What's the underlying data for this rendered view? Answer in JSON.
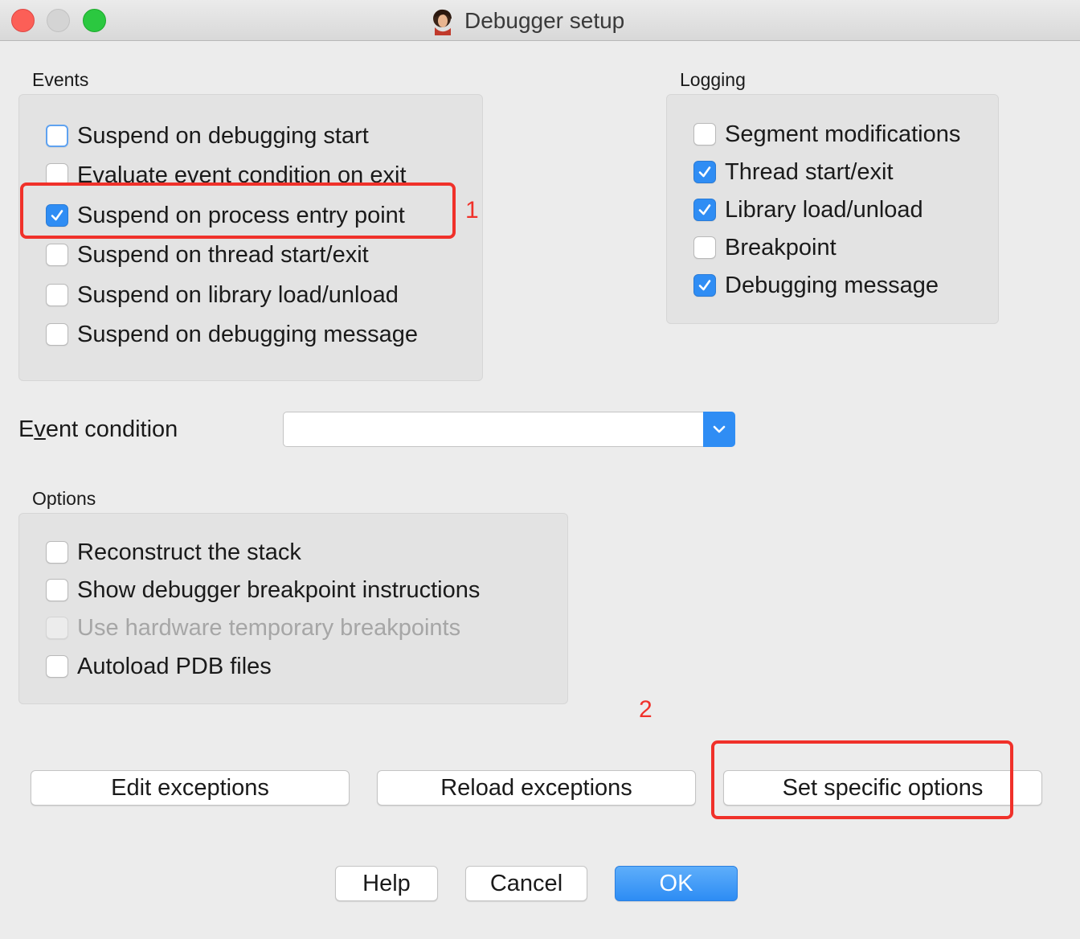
{
  "window": {
    "title": "Debugger setup"
  },
  "events": {
    "label": "Events",
    "items": [
      {
        "label": "Suspend on debugging start",
        "checked": false
      },
      {
        "label": "Evaluate event condition on exit",
        "checked": false
      },
      {
        "label": "Suspend on process entry point",
        "checked": true
      },
      {
        "label": "Suspend on thread start/exit",
        "checked": false
      },
      {
        "label": "Suspend on library load/unload",
        "checked": false
      },
      {
        "label": "Suspend on debugging message",
        "checked": false
      }
    ]
  },
  "logging": {
    "label": "Logging",
    "items": [
      {
        "label": "Segment modifications",
        "checked": false
      },
      {
        "label": "Thread start/exit",
        "checked": true
      },
      {
        "label": "Library load/unload",
        "checked": true
      },
      {
        "label": "Breakpoint",
        "checked": false
      },
      {
        "label": "Debugging message",
        "checked": true
      }
    ]
  },
  "event_condition": {
    "label_pre": "E",
    "label_u": "v",
    "label_post": "ent condition",
    "value": ""
  },
  "options": {
    "label": "Options",
    "items": [
      {
        "label": "Reconstruct the stack",
        "checked": false
      },
      {
        "label": "Show debugger breakpoint instructions",
        "checked": false
      },
      {
        "label": "Use hardware temporary breakpoints",
        "checked": false,
        "disabled": true
      },
      {
        "label": "Autoload PDB files",
        "checked": false
      }
    ]
  },
  "annotations": {
    "first": "1",
    "second": "2"
  },
  "buttons": {
    "edit_exceptions": "Edit exceptions",
    "reload_exceptions": "Reload exceptions",
    "set_specific_options": "Set specific options",
    "help": "Help",
    "cancel": "Cancel",
    "ok": "OK"
  },
  "colors": {
    "accent": "#2f8df4",
    "annotation": "#f0312a",
    "background": "#ececec"
  }
}
